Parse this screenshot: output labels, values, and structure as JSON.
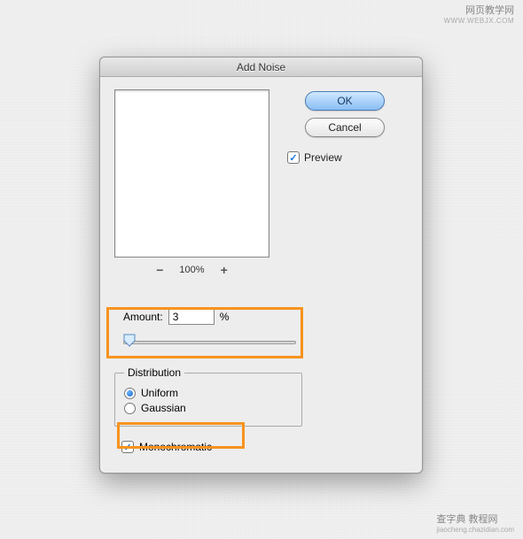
{
  "watermark_top": {
    "main": "网页教学网",
    "sub": "WWW.WEBJX.COM"
  },
  "watermark_bottom": {
    "main": "查字典 教程网",
    "sub": "jiaocheng.chazidian.com"
  },
  "dialog": {
    "title": "Add Noise",
    "ok_label": "OK",
    "cancel_label": "Cancel",
    "preview_label": "Preview",
    "preview_checked": true,
    "zoom": {
      "minus": "−",
      "value": "100%",
      "plus": "+"
    },
    "amount": {
      "label": "Amount:",
      "value": "3",
      "unit": "%"
    },
    "distribution": {
      "legend": "Distribution",
      "options": [
        {
          "label": "Uniform",
          "selected": true
        },
        {
          "label": "Gaussian",
          "selected": false
        }
      ]
    },
    "monochromatic": {
      "label": "Monochromatic",
      "checked": true
    }
  }
}
